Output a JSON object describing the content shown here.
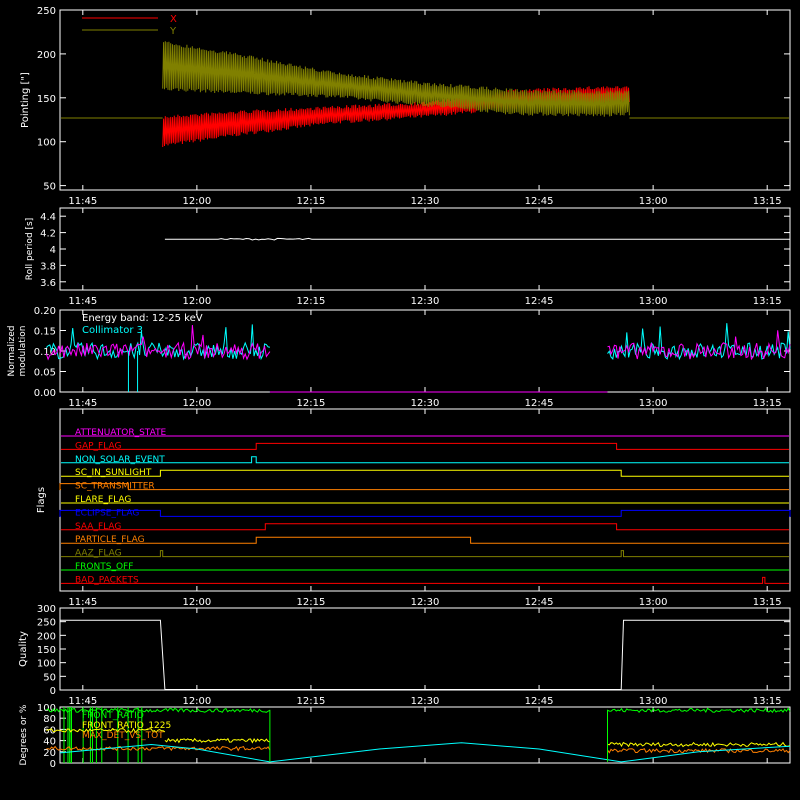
{
  "chart_data": [
    {
      "type": "line",
      "ylabel": "Pointing [\"]",
      "ylim": [
        45,
        250
      ],
      "yticks": [
        50,
        100,
        150,
        200,
        250
      ],
      "xticks": [
        "11:45",
        "12:00",
        "12:15",
        "12:30",
        "12:45",
        "13:00",
        "13:15"
      ],
      "legend": "top-left",
      "series": [
        {
          "name": "X",
          "color": "#ff0000",
          "baseline": 127,
          "envelope_low": [
            [
              11.93,
              94
            ],
            [
              12.1,
              107
            ],
            [
              12.3,
              120
            ],
            [
              12.5,
              127
            ],
            [
              12.7,
              137
            ],
            [
              12.9,
              142
            ],
            [
              12.95,
              145
            ]
          ],
          "envelope_high": [
            [
              11.93,
              130
            ],
            [
              12.1,
              136
            ],
            [
              12.3,
              141
            ],
            [
              12.5,
              146
            ],
            [
              12.7,
              160
            ],
            [
              12.9,
              164
            ],
            [
              12.95,
              163
            ]
          ]
        },
        {
          "name": "Y",
          "color": "#808000",
          "baseline": 127,
          "envelope_low": [
            [
              11.93,
              158
            ],
            [
              12.1,
              154
            ],
            [
              12.3,
              150
            ],
            [
              12.5,
              140
            ],
            [
              12.7,
              130
            ],
            [
              12.9,
              128
            ],
            [
              12.95,
              130
            ]
          ],
          "envelope_high": [
            [
              11.93,
              215
            ],
            [
              12.1,
              200
            ],
            [
              12.3,
              180
            ],
            [
              12.5,
              168
            ],
            [
              12.7,
              160
            ],
            [
              12.9,
              158
            ],
            [
              12.95,
              159
            ]
          ]
        }
      ]
    },
    {
      "type": "line",
      "ylabel": "Roll period [s]",
      "ylim": [
        3.5,
        4.5
      ],
      "yticks": [
        3.6,
        3.8,
        4.0,
        4.2,
        4.4
      ],
      "xticks": [
        "11:45",
        "12:00",
        "12:15",
        "12:30",
        "12:45",
        "13:00",
        "13:15"
      ],
      "series": [
        {
          "color": "#ffffff",
          "constant": 4.12
        }
      ]
    },
    {
      "type": "line",
      "ylabel": "Normalized modulation",
      "ylim": [
        0.0,
        0.2
      ],
      "yticks": [
        "0.00",
        "0.05",
        "0.10",
        "0.15",
        "0.20"
      ],
      "xticks": [
        "11:45",
        "12:00",
        "12:15",
        "12:30",
        "12:45",
        "13:00",
        "13:15"
      ],
      "legend": "top-left",
      "annotations": [
        "Energy band: 12-25 keV"
      ],
      "series": [
        {
          "name": "Collimator 3",
          "color": "#00ffff",
          "mean": 0.1,
          "active": [
            [
              11.67,
              12.16
            ],
            [
              12.9,
              13.3
            ]
          ]
        },
        {
          "color": "#ff00ff",
          "mean": 0.1,
          "active": [
            [
              11.67,
              12.16
            ],
            [
              12.9,
              13.3
            ]
          ]
        }
      ]
    },
    {
      "type": "line",
      "ylabel": "Flags",
      "xticks": [
        "11:45",
        "12:00",
        "12:15",
        "12:30",
        "12:45",
        "13:00",
        "13:15"
      ],
      "series": [
        {
          "name": "ATTENUATOR_STATE",
          "color": "#ff00ff",
          "on": []
        },
        {
          "name": "GAP_FLAG",
          "color": "#ff0000",
          "on": [
            [
              12.13,
              12.92
            ]
          ]
        },
        {
          "name": "NON_SOLAR_EVENT",
          "color": "#00ffff",
          "on": [
            [
              12.12,
              12.13
            ]
          ]
        },
        {
          "name": "SC_IN_SUNLIGHT",
          "color": "#ffff00",
          "on": [
            [
              11.92,
              12.93
            ]
          ]
        },
        {
          "name": "SC_TRANSMITTER",
          "color": "#ff8000",
          "on": [
            [
              11.7,
              11.85
            ]
          ]
        },
        {
          "name": "FLARE_FLAG",
          "color": "#ffff00",
          "on": []
        },
        {
          "name": "ECLIPSE_FLAG",
          "color": "#0000ff",
          "on": [
            [
              11.7,
              11.92
            ],
            [
              12.93,
              13.3
            ]
          ]
        },
        {
          "name": "SAA_FLAG",
          "color": "#ff0000",
          "on": [
            [
              12.15,
              12.92
            ]
          ]
        },
        {
          "name": "PARTICLE_FLAG",
          "color": "#ff8000",
          "on": [
            [
              12.13,
              12.6
            ]
          ]
        },
        {
          "name": "AAZ_FLAG",
          "color": "#808000",
          "on": [
            [
              11.92,
              11.925
            ],
            [
              12.93,
              12.935
            ]
          ]
        },
        {
          "name": "FRONTS_OFF",
          "color": "#00ff00",
          "on": []
        },
        {
          "name": "BAD_PACKETS",
          "color": "#ff0000",
          "on": [
            [
              13.24,
              13.245
            ]
          ]
        }
      ]
    },
    {
      "type": "line",
      "ylabel": "Quality",
      "ylim": [
        0,
        300
      ],
      "yticks": [
        0,
        50,
        100,
        150,
        200,
        250,
        300
      ],
      "xticks": [
        "11:45",
        "12:00",
        "12:15",
        "12:30",
        "12:45",
        "13:00",
        "13:15"
      ],
      "series": [
        {
          "color": "#ffffff",
          "points": [
            [
              11.67,
              255
            ],
            [
              11.92,
              255
            ],
            [
              11.93,
              2
            ],
            [
              12.93,
              2
            ],
            [
              12.935,
              255
            ],
            [
              13.3,
              255
            ]
          ]
        }
      ]
    },
    {
      "type": "line",
      "ylabel": "Degrees or %",
      "ylim": [
        0,
        100
      ],
      "yticks": [
        0,
        20,
        40,
        60,
        80,
        100
      ],
      "legend": "top-left",
      "series": [
        {
          "name": "FRONT_RATIO",
          "color": "#00ff00",
          "segments": [
            [
              11.67,
              12.16,
              94
            ],
            [
              12.9,
              13.3,
              94
            ]
          ]
        },
        {
          "name": "FRONT_RATIO_1225",
          "color": "#ffff00",
          "segments": [
            [
              11.67,
              11.93,
              58
            ],
            [
              11.93,
              12.16,
              40
            ],
            [
              12.9,
              13.3,
              33
            ]
          ]
        },
        {
          "name": "MAX_DET_VS_TOT",
          "color": "#ff8000",
          "segments": [
            [
              11.67,
              12.16,
              26
            ],
            [
              12.9,
              13.3,
              22
            ]
          ]
        },
        {
          "color": "#00ffff",
          "points": [
            [
              11.67,
              18
            ],
            [
              11.9,
              33
            ],
            [
              12.0,
              25
            ],
            [
              12.16,
              2
            ],
            [
              12.4,
              25
            ],
            [
              12.58,
              36
            ],
            [
              12.75,
              25
            ],
            [
              12.93,
              2
            ],
            [
              13.1,
              20
            ],
            [
              13.3,
              30
            ]
          ]
        }
      ]
    }
  ]
}
